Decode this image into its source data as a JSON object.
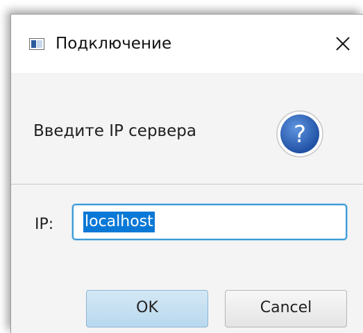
{
  "dialog": {
    "title": "Подключение",
    "header_text": "Введите IP сервера",
    "ip_label": "IP:",
    "ip_value": "localhost",
    "ok_label": "OK",
    "cancel_label": "Cancel"
  },
  "icons": {
    "app": "application-window-icon",
    "close": "close-icon",
    "help": "question-mark-icon"
  },
  "colors": {
    "accent": "#0a78d7",
    "help_icon": "#2a63b8",
    "ok_button": "#c6e0f2"
  }
}
